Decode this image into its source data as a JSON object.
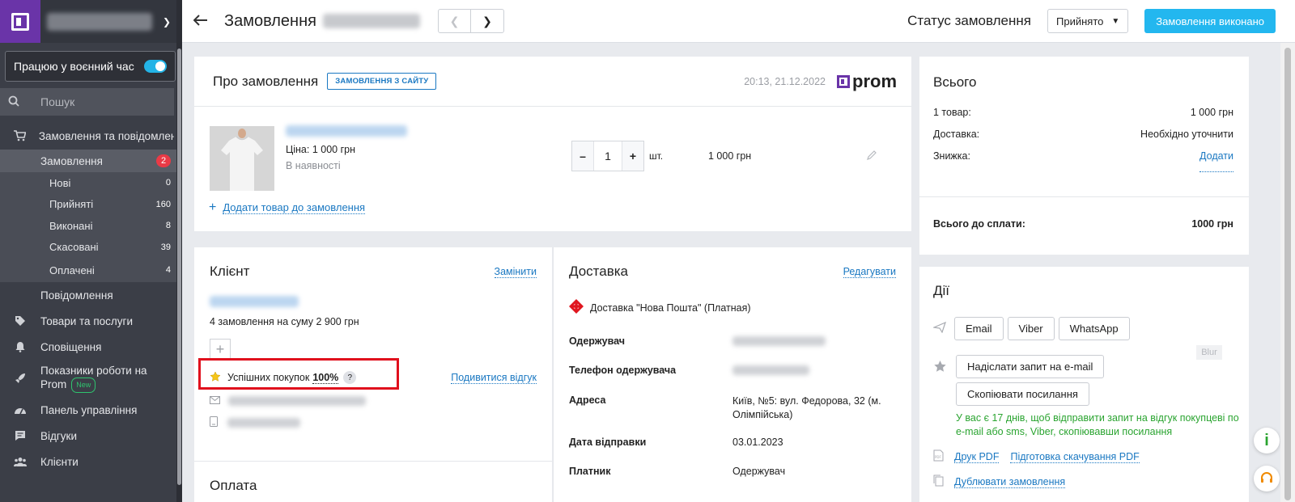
{
  "sidebar": {
    "war_mode_label": "Працюю у воєнний час",
    "search_placeholder": "Пошук",
    "orders_group": "Замовлення та повідомлення",
    "orders": {
      "label": "Замовлення",
      "badge": "2"
    },
    "order_subitems": [
      {
        "label": "Нові",
        "count": "0"
      },
      {
        "label": "Прийняті",
        "count": "160"
      },
      {
        "label": "Виконані",
        "count": "8"
      },
      {
        "label": "Скасовані",
        "count": "39"
      },
      {
        "label": "Оплачені",
        "count": "4"
      }
    ],
    "messages": "Повідомлення",
    "products": "Товари та послуги",
    "notifications": "Сповіщення",
    "performance": "Показники роботи на Prom",
    "new_badge": "New",
    "dashboard": "Панель управління",
    "reviews": "Відгуки",
    "clients": "Клієнти"
  },
  "header": {
    "title": "Замовлення",
    "status_label": "Статус замовлення",
    "status_value": "Прийнято",
    "complete_button": "Замовлення виконано"
  },
  "order": {
    "title": "Про замовлення",
    "source_tag": "ЗАМОВЛЕННЯ З САЙТУ",
    "date": "20:13, 21.12.2022",
    "brand": "prom",
    "item": {
      "price": "Ціна: 1 000 грн",
      "availability": "В наявності",
      "quantity": "1",
      "unit": "шт.",
      "total": "1 000 грн"
    },
    "add_item": "Додати товар до замовлення"
  },
  "client": {
    "title": "Клієнт",
    "change": "Замінити",
    "orders_summary": "4 замовлення на суму 2 900 грн",
    "success_label": "Успішних покупок",
    "success_value": "100%",
    "view_review": "Подивитися відгук",
    "payment_title": "Оплата"
  },
  "delivery": {
    "title": "Доставка",
    "edit": "Редагувати",
    "method": "Доставка \"Нова Пошта\" (Платная)",
    "fields": [
      {
        "label": "Одержувач",
        "value": ""
      },
      {
        "label": "Телефон одержувача",
        "value": ""
      },
      {
        "label": "Адреса",
        "value": "Київ, №5: вул. Федорова, 32 (м. Олімпійська)"
      },
      {
        "label": "Дата відправки",
        "value": "03.01.2023"
      },
      {
        "label": "Платник",
        "value": "Одержувач"
      }
    ]
  },
  "totals": {
    "title": "Всього",
    "rows": [
      {
        "label": "1 товар:",
        "value": "1 000 грн"
      },
      {
        "label": "Доставка:",
        "value": "Необхідно уточнити"
      },
      {
        "label": "Знижка:",
        "value": "Додати"
      }
    ],
    "grand_label": "Всього до сплати:",
    "grand_value": "1000 грн"
  },
  "actions": {
    "title": "Дії",
    "email": "Email",
    "viber": "Viber",
    "whatsapp": "WhatsApp",
    "blur_tag": "Blur",
    "send_review_request": "Надіслати запит на e-mail",
    "copy_link": "Скопіювати посилання",
    "hint": "У вас є 17 днів, щоб відправити запит на відгук покупцеві по e-mail або sms, Viber, скопіювавши посилання",
    "print_pdf": "Друк PDF",
    "prepare_pdf": "Підготовка скачування PDF",
    "duplicate": "Дублювати замовлення"
  }
}
